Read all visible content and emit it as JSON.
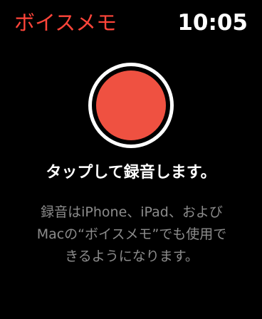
{
  "status_bar": {
    "app_title": "ボイスメモ",
    "time": "10:05"
  },
  "record": {
    "icon": "record-icon",
    "prompt": "タップして録音します。"
  },
  "description": {
    "lines": [
      "録音はiPhone、iPad、および",
      "Macの“ボイスメモ”でも使用で",
      "きるようになります。"
    ]
  },
  "colors": {
    "accent": "#ff453a",
    "record_red": "#ef5141",
    "background": "#000000",
    "secondary_text": "#8c8c8c"
  }
}
